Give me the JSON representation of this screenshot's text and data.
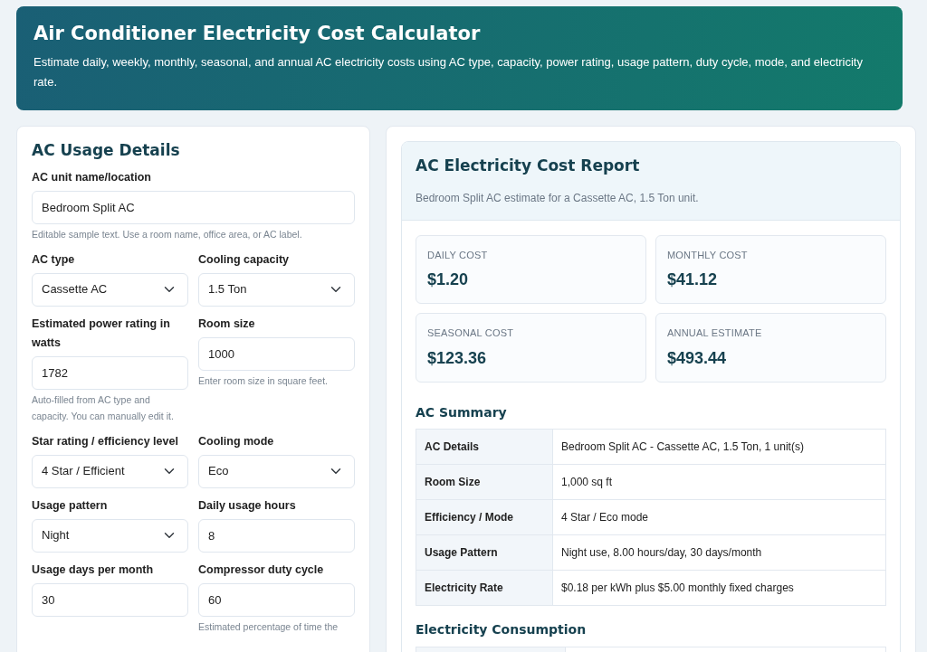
{
  "header": {
    "title": "Air Conditioner Electricity Cost Calculator",
    "description": "Estimate daily, weekly, monthly, seasonal, and annual AC electricity costs using AC type, capacity, power rating, usage pattern, duty cycle, mode, and electricity rate."
  },
  "form": {
    "title": "AC Usage Details",
    "rows": [
      [
        {
          "label": "AC unit name/location",
          "kind": "text",
          "value": "Bedroom Split AC",
          "help": "Editable sample text. Use a room name, office area, or AC label."
        }
      ],
      [
        {
          "label": "AC type",
          "kind": "select",
          "value": "Cassette AC"
        },
        {
          "label": "Cooling capacity",
          "kind": "select",
          "value": "1.5 Ton"
        }
      ],
      [
        {
          "label": "Estimated power rating in watts",
          "kind": "text",
          "value": "1782",
          "help": "Auto-filled from AC type and capacity. You can manually edit it."
        },
        {
          "label": "Room size",
          "kind": "text",
          "value": "1000",
          "help": "Enter room size in square feet."
        }
      ],
      [
        {
          "label": "Star rating / efficiency level",
          "kind": "select",
          "value": "4 Star / Efficient"
        },
        {
          "label": "Cooling mode",
          "kind": "select",
          "value": "Eco"
        }
      ],
      [
        {
          "label": "Usage pattern",
          "kind": "select",
          "value": "Night"
        },
        {
          "label": "Daily usage hours",
          "kind": "text",
          "value": "8"
        }
      ],
      [
        {
          "label": "Usage days per month",
          "kind": "text",
          "value": "30"
        },
        {
          "label": "Compressor duty cycle",
          "kind": "text",
          "value": "60",
          "help": "Estimated percentage of time the"
        }
      ]
    ]
  },
  "report": {
    "title": "AC Electricity Cost Report",
    "subtitle": "Bedroom Split AC estimate for a Cassette AC, 1.5 Ton unit.",
    "stats": [
      {
        "label": "DAILY COST",
        "value": "$1.20"
      },
      {
        "label": "MONTHLY COST",
        "value": "$41.12"
      },
      {
        "label": "SEASONAL COST",
        "value": "$123.36"
      },
      {
        "label": "ANNUAL ESTIMATE",
        "value": "$493.44"
      }
    ],
    "sections": [
      {
        "title": "AC Summary",
        "rows": [
          {
            "label": "AC Details",
            "value": "Bedroom Split AC - Cassette AC, 1.5 Ton, 1 unit(s)"
          },
          {
            "label": "Room Size",
            "value": "1,000 sq ft"
          },
          {
            "label": "Efficiency / Mode",
            "value": "4 Star / Eco mode"
          },
          {
            "label": "Usage Pattern",
            "value": "Night use, 8.00 hours/day, 30 days/month"
          },
          {
            "label": "Electricity Rate",
            "value": "$0.18 per kWh plus $5.00 monthly fixed charges"
          }
        ]
      },
      {
        "title": "Electricity Consumption"
      }
    ]
  }
}
